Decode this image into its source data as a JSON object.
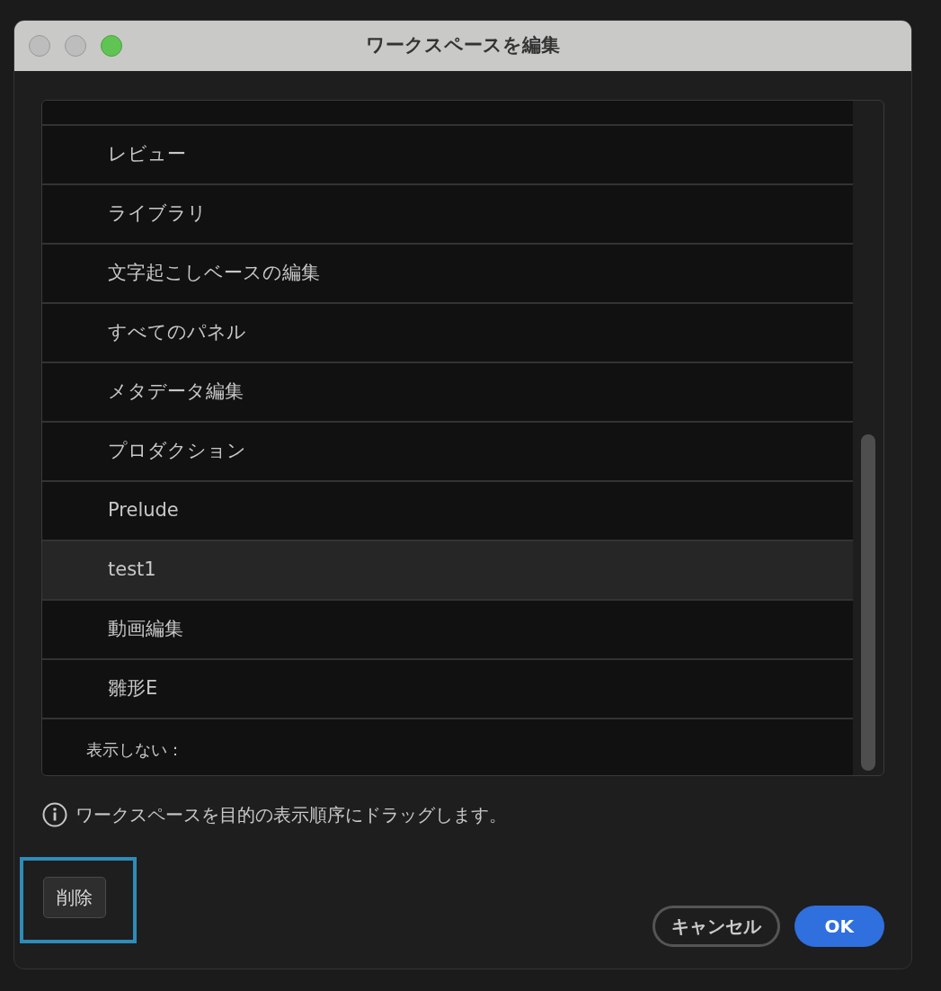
{
  "window": {
    "title": "ワークスペースを編集"
  },
  "workspaces": [
    {
      "label": "レビュー",
      "kind": "item",
      "selected": false
    },
    {
      "label": "ライブラリ",
      "kind": "item",
      "selected": false
    },
    {
      "label": "文字起こしベースの編集",
      "kind": "item",
      "selected": false
    },
    {
      "label": "すべてのパネル",
      "kind": "item",
      "selected": false
    },
    {
      "label": "メタデータ編集",
      "kind": "item",
      "selected": false
    },
    {
      "label": "プロダクション",
      "kind": "item",
      "selected": false
    },
    {
      "label": "Prelude",
      "kind": "item",
      "selected": false
    },
    {
      "label": "test1",
      "kind": "item",
      "selected": true
    },
    {
      "label": "動画編集",
      "kind": "item",
      "selected": false
    },
    {
      "label": "雛形E",
      "kind": "item",
      "selected": false
    }
  ],
  "hidden_section": "表示しない：",
  "hint": "ワークスペースを目的の表示順序にドラッグします。",
  "buttons": {
    "delete": "削除",
    "cancel": "キャンセル",
    "ok": "OK"
  }
}
